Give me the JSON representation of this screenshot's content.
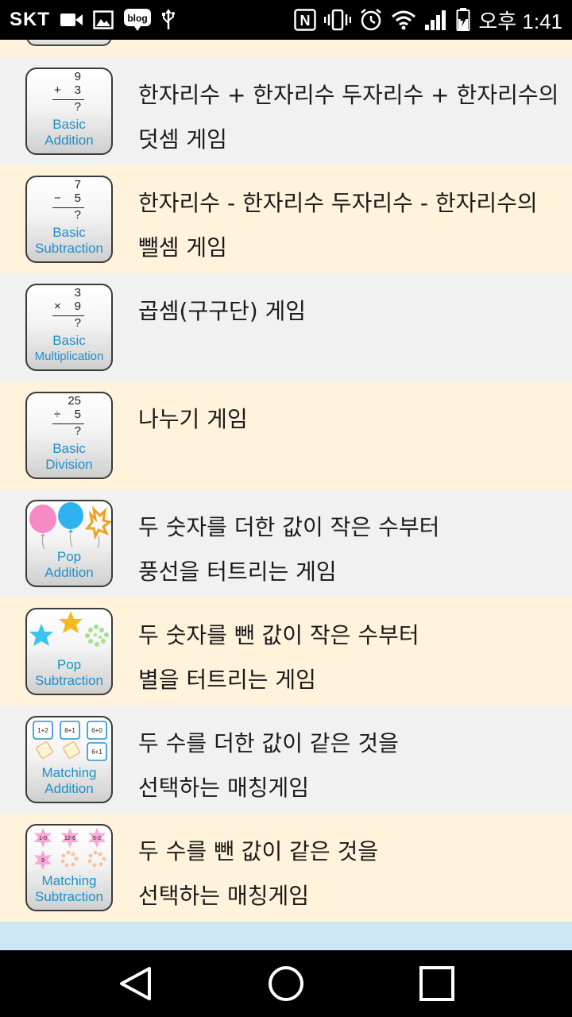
{
  "status_bar": {
    "carrier": "SKT",
    "notification_icons": [
      "video-camera-icon",
      "image-icon",
      "blog-icon",
      "usb-icon"
    ],
    "blog_label": "blog",
    "system_icons": [
      "nfc-icon",
      "vibrate-icon",
      "alarm-icon",
      "wifi-icon",
      "signal-icon",
      "battery-icon"
    ],
    "time": "오후 1:41"
  },
  "games": [
    {
      "id": "basic-addition",
      "icon_caption_1": "Basic",
      "icon_caption_2": "Addition",
      "problem": {
        "top": "9",
        "operator": "+",
        "bottom": "3",
        "result": "?"
      },
      "line1": "한자리수 + 한자리수 두자리수 + 한자리수의",
      "line2": "덧셈 게임"
    },
    {
      "id": "basic-subtraction",
      "icon_caption_1": "Basic",
      "icon_caption_2": "Subtraction",
      "problem": {
        "top": "7",
        "operator": "−",
        "bottom": "5",
        "result": "?"
      },
      "line1": "한자리수 - 한자리수 두자리수 - 한자리수의",
      "line2": "뺄셈 게임"
    },
    {
      "id": "basic-multiplication",
      "icon_caption_1": "Basic",
      "icon_caption_2": "Multiplication",
      "problem": {
        "top": "3",
        "operator": "×",
        "bottom": "9",
        "result": "?"
      },
      "line1": "곱셈(구구단) 게임",
      "line2": ""
    },
    {
      "id": "basic-division",
      "icon_caption_1": "Basic",
      "icon_caption_2": "Division",
      "problem": {
        "top": "25",
        "operator": "÷",
        "bottom": "5",
        "result": "?"
      },
      "line1": "나누기 게임",
      "line2": ""
    },
    {
      "id": "pop-addition",
      "icon_caption_1": "Pop",
      "icon_caption_2": "Addition",
      "line1": "두 숫자를 더한 값이 작은 수부터",
      "line2": "풍선을 터트리는 게임"
    },
    {
      "id": "pop-subtraction",
      "icon_caption_1": "Pop",
      "icon_caption_2": "Subtraction",
      "line1": "두 숫자를 뺀 값이 작은 수부터",
      "line2": "별을 터트리는 게임"
    },
    {
      "id": "matching-addition",
      "icon_caption_1": "Matching",
      "icon_caption_2": "Addition",
      "cards": [
        "1+2",
        "8+1",
        "6+0",
        "6+1"
      ],
      "line1": "두 수를 더한 값이 같은 것을",
      "line2": "선택하는 매칭게임"
    },
    {
      "id": "matching-subtraction",
      "icon_caption_1": "Matching",
      "icon_caption_2": "Subtraction",
      "cards": [
        "1-0",
        "12-6",
        "5-2",
        "9"
      ],
      "line1": "두 수를 뺀 값이 같은 것을",
      "line2": "선택하는 매칭게임"
    }
  ],
  "nav_bar": {
    "back": "back-triangle-icon",
    "home": "home-circle-icon",
    "recents": "recents-square-icon"
  },
  "colors": {
    "row_gray": "#f1f1f1",
    "row_cream": "#fff3dc",
    "caption_blue": "#1f8fc9"
  }
}
